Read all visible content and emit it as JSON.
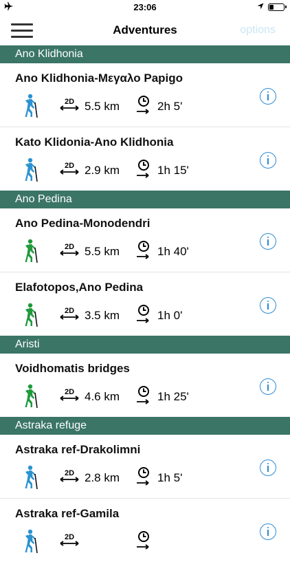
{
  "status_bar": {
    "time": "23:06",
    "battery_level": 0.3
  },
  "nav": {
    "title": "Adventures",
    "options_label": "options"
  },
  "sections": [
    {
      "name": "Ano Klidhonia",
      "items": [
        {
          "title": "Ano Klidhonia-Μεγαλο Papigo",
          "distance": "5.5 km",
          "duration": "2h 5'",
          "difficulty_color": "#2b93d1"
        },
        {
          "title": "Kato Klidonia-Ano Klidhonia",
          "distance": "2.9 km",
          "duration": "1h 15'",
          "difficulty_color": "#2b93d1"
        }
      ]
    },
    {
      "name": "Ano Pedina",
      "items": [
        {
          "title": "Ano Pedina-Monodendri",
          "distance": "5.5 km",
          "duration": "1h 40'",
          "difficulty_color": "#1f9a3c"
        },
        {
          "title": "Elafotopos,Ano Pedina",
          "distance": "3.5 km",
          "duration": "1h 0'",
          "difficulty_color": "#1f9a3c"
        }
      ]
    },
    {
      "name": "Aristi",
      "items": [
        {
          "title": "Voidhomatis bridges",
          "distance": "4.6 km",
          "duration": "1h 25'",
          "difficulty_color": "#1f9a3c"
        }
      ]
    },
    {
      "name": "Astraka refuge",
      "items": [
        {
          "title": "Astraka ref-Drakolimni",
          "distance": "2.8 km",
          "duration": "1h 5'",
          "difficulty_color": "#2b93d1"
        },
        {
          "title": "Astraka ref-Gamila",
          "distance": "",
          "duration": "",
          "difficulty_color": "#2b93d1"
        }
      ]
    }
  ]
}
